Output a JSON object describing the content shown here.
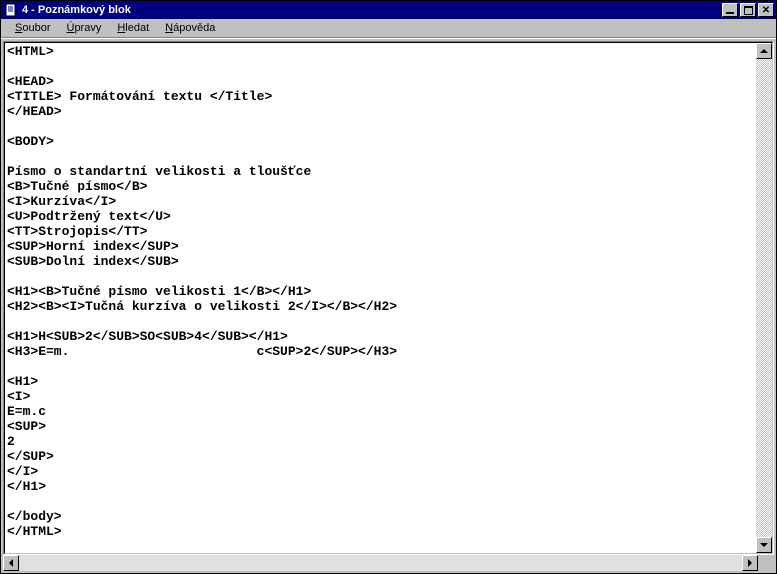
{
  "window": {
    "title": "4 - Poznámkový blok"
  },
  "menu": {
    "file": "Soubor",
    "edit": "Úpravy",
    "search": "Hledat",
    "help": "Nápověda"
  },
  "editor": {
    "content": "<HTML>\n\n<HEAD>\n<TITLE> Formátování textu </Title>\n</HEAD>\n\n<BODY>\n\nPísmo o standartní velikosti a tloušťce\n<B>Tučné písmo</B>\n<I>Kurzíva</I>\n<U>Podtržený text</U>\n<TT>Strojopis</TT>\n<SUP>Horní index</SUP>\n<SUB>Dolní index</SUB>\n\n<H1><B>Tučné písmo velikosti 1</B></H1>\n<H2><B><I>Tučná kurzíva o velikosti 2</I></B></H2>\n\n<H1>H<SUB>2</SUB>SO<SUB>4</SUB></H1>\n<H3>E=m.                        c<SUP>2</SUP></H3>\n\n<H1>\n<I>\nE=m.c\n<SUP>\n2\n</SUP>\n</I>\n</H1>\n\n</body>\n</HTML>"
  }
}
